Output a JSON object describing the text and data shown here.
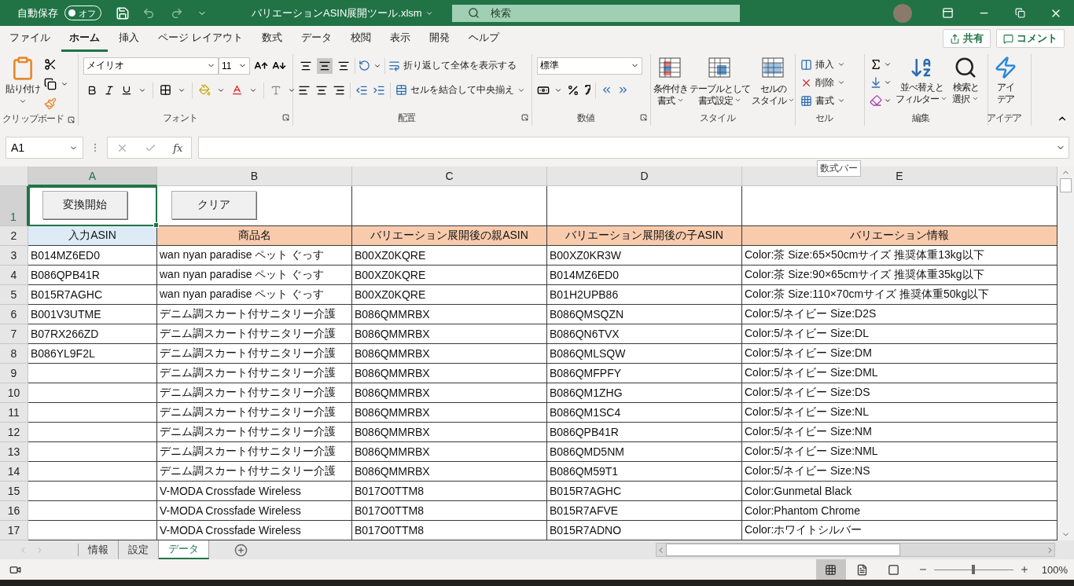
{
  "title_bar": {
    "autosave_label": "自動保存",
    "autosave_toggle": {
      "label": "オフ",
      "on": false
    },
    "filename": "バリエーションASIN展開ツール.xlsm",
    "search_placeholder": "検索"
  },
  "menu_tabs": [
    {
      "label": "ファイル",
      "selected": false
    },
    {
      "label": "ホーム",
      "selected": true
    },
    {
      "label": "挿入",
      "selected": false
    },
    {
      "label": "ページ レイアウト",
      "selected": false
    },
    {
      "label": "数式",
      "selected": false
    },
    {
      "label": "データ",
      "selected": false
    },
    {
      "label": "校閲",
      "selected": false
    },
    {
      "label": "表示",
      "selected": false
    },
    {
      "label": "開発",
      "selected": false
    },
    {
      "label": "ヘルプ",
      "selected": false
    }
  ],
  "share_button": "共有",
  "comment_button": "コメント",
  "ribbon": {
    "clipboard": {
      "paste": "貼り付け",
      "label": "クリップボード"
    },
    "font": {
      "name": "メイリオ",
      "size": "11",
      "label": "フォント"
    },
    "alignment": {
      "vertical": [
        {
          "selected": false
        },
        {
          "selected": true
        },
        {
          "selected": false
        }
      ],
      "wrap": "折り返して全体を表示する",
      "merge": "セルを結合して中央揃え",
      "label": "配置"
    },
    "number": {
      "format": "標準",
      "label": "数値"
    },
    "styles": {
      "buttons": [
        {
          "lines": [
            "条件付き",
            "書式"
          ]
        },
        {
          "lines": [
            "テーブルとして",
            "書式設定"
          ]
        },
        {
          "lines": [
            "セルの",
            "スタイル"
          ]
        }
      ],
      "label": "スタイル"
    },
    "cells": {
      "buttons": [
        "挿入",
        "削除",
        "書式"
      ],
      "label": "セル"
    },
    "editing": {
      "buttons": [
        {
          "lines": [
            "並べ替えと",
            "フィルター"
          ]
        },
        {
          "lines": [
            "検索と",
            "選択"
          ]
        }
      ],
      "label": "編集"
    },
    "ideas": {
      "lines": [
        "アイ",
        "デア"
      ],
      "label": "アイデア"
    }
  },
  "formula_bar": {
    "name_box": "A1",
    "function_label": "fx",
    "tooltip": "数式バー"
  },
  "sheet": {
    "columns": [
      {
        "label": "A",
        "selected": true
      },
      {
        "label": "B",
        "selected": false
      },
      {
        "label": "C",
        "selected": false
      },
      {
        "label": "D",
        "selected": false
      },
      {
        "label": "E",
        "selected": false
      }
    ],
    "button_row": {
      "number": "1",
      "selected": true,
      "buttons": [
        "変換開始",
        "クリア"
      ]
    },
    "header_row": {
      "number": "2",
      "cells": [
        {
          "text": "入力ASIN",
          "color": "#ddebf7"
        },
        {
          "text": "商品名",
          "color": "#f8cbad"
        },
        {
          "text": "バリエーション展開後の親ASIN",
          "color": "#f8cbad"
        },
        {
          "text": "バリエーション展開後の子ASIN",
          "color": "#f8cbad"
        },
        {
          "text": "バリエーション情報",
          "color": "#f8cbad"
        }
      ]
    },
    "rows": [
      {
        "number": "3",
        "input_asin": "B014MZ6ED0",
        "product": "wan nyan paradise ペット ぐっす",
        "parent": "B00XZ0KQRE",
        "child": "B00XZ0KR3W",
        "info": "Color:茶 Size:65×50cmサイズ 推奨体重13kg以下"
      },
      {
        "number": "4",
        "input_asin": "B086QPB41R",
        "product": "wan nyan paradise ペット ぐっす",
        "parent": "B00XZ0KQRE",
        "child": "B014MZ6ED0",
        "info": "Color:茶 Size:90×65cmサイズ 推奨体重35kg以下"
      },
      {
        "number": "5",
        "input_asin": "B015R7AGHC",
        "product": "wan nyan paradise ペット ぐっす",
        "parent": "B00XZ0KQRE",
        "child": "B01H2UPB86",
        "info": "Color:茶 Size:110×70cmサイズ 推奨体重50kg以下"
      },
      {
        "number": "6",
        "input_asin": "B001V3UTME",
        "product": "デニム調スカート付サニタリー介護",
        "parent": "B086QMMRBX",
        "child": "B086QMSQZN",
        "info": "Color:5/ネイビー Size:D2S"
      },
      {
        "number": "7",
        "input_asin": "B07RX266ZD",
        "product": "デニム調スカート付サニタリー介護",
        "parent": "B086QMMRBX",
        "child": "B086QN6TVX",
        "info": "Color:5/ネイビー Size:DL"
      },
      {
        "number": "8",
        "input_asin": "B086YL9F2L",
        "product": "デニム調スカート付サニタリー介護",
        "parent": "B086QMMRBX",
        "child": "B086QMLSQW",
        "info": "Color:5/ネイビー Size:DM"
      },
      {
        "number": "9",
        "product": "デニム調スカート付サニタリー介護",
        "parent": "B086QMMRBX",
        "child": "B086QMFPFY",
        "info": "Color:5/ネイビー Size:DML"
      },
      {
        "number": "10",
        "product": "デニム調スカート付サニタリー介護",
        "parent": "B086QMMRBX",
        "child": "B086QM1ZHG",
        "info": "Color:5/ネイビー Size:DS"
      },
      {
        "number": "11",
        "product": "デニム調スカート付サニタリー介護",
        "parent": "B086QMMRBX",
        "child": "B086QM1SC4",
        "info": "Color:5/ネイビー Size:NL"
      },
      {
        "number": "12",
        "product": "デニム調スカート付サニタリー介護",
        "parent": "B086QMMRBX",
        "child": "B086QPB41R",
        "info": "Color:5/ネイビー Size:NM"
      },
      {
        "number": "13",
        "product": "デニム調スカート付サニタリー介護",
        "parent": "B086QMMRBX",
        "child": "B086QMD5NM",
        "info": "Color:5/ネイビー Size:NML"
      },
      {
        "number": "14",
        "product": "デニム調スカート付サニタリー介護",
        "parent": "B086QMMRBX",
        "child": "B086QM59T1",
        "info": "Color:5/ネイビー Size:NS"
      },
      {
        "number": "15",
        "product": "V-MODA Crossfade Wireless",
        "parent": "B017O0TTM8",
        "child": "B015R7AGHC",
        "info": "Color:Gunmetal Black"
      },
      {
        "number": "16",
        "product": "V-MODA Crossfade Wireless",
        "parent": "B017O0TTM8",
        "child": "B015R7AFVE",
        "info": "Color:Phantom Chrome"
      },
      {
        "number": "17",
        "product": "V-MODA Crossfade Wireless",
        "parent": "B017O0TTM8",
        "child": "B015R7ADNO",
        "info": "Color:ホワイトシルバー"
      }
    ]
  },
  "sheet_tabs": [
    {
      "label": "情報",
      "selected": false
    },
    {
      "label": "設定",
      "selected": false
    },
    {
      "label": "データ",
      "selected": true
    }
  ],
  "status_bar": {
    "views": [
      {
        "selected": true
      },
      {
        "selected": false
      },
      {
        "selected": false
      }
    ],
    "zoom": {
      "level": 0.5,
      "reading": "100%"
    }
  }
}
